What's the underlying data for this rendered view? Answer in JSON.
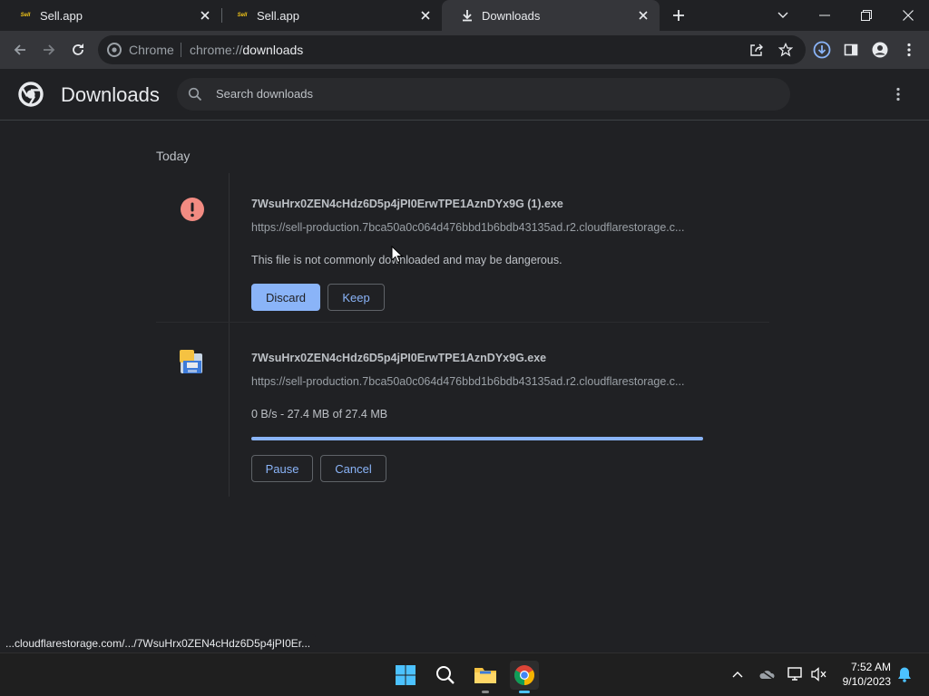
{
  "tabs": [
    {
      "title": "Sell.app",
      "favicon": "sell-app-logo",
      "favicon_text": "Sell"
    },
    {
      "title": "Sell.app",
      "favicon": "sell-app-logo",
      "favicon_text": "Sell"
    },
    {
      "title": "Downloads",
      "favicon": "download-icon",
      "active": true
    }
  ],
  "omnibox": {
    "site_label": "Chrome",
    "url_scheme": "chrome://",
    "url_host": "downloads"
  },
  "downloads_page": {
    "title": "Downloads",
    "search_placeholder": "Search downloads",
    "date_group": "Today",
    "items": [
      {
        "filename": "7WsuHrx0ZEN4cHdz6D5p4jPI0ErwTPE1AznDYx9G (1).exe",
        "url": "https://sell-production.7bca50a0c064d476bbd1b6bdb43135ad.r2.cloudflarestorage.c...",
        "status": "This file is not commonly downloaded and may be dangerous.",
        "icon": "warning-icon",
        "buttons": {
          "discard": "Discard",
          "keep": "Keep"
        }
      },
      {
        "filename": "7WsuHrx0ZEN4cHdz6D5p4jPI0ErwTPE1AznDYx9G.exe",
        "url": "https://sell-production.7bca50a0c064d476bbd1b6bdb43135ad.r2.cloudflarestorage.c...",
        "status": "0 B/s - 27.4 MB of 27.4 MB",
        "progress": 1.0,
        "icon": "installer-file-icon",
        "buttons": {
          "pause": "Pause",
          "cancel": "Cancel"
        }
      }
    ]
  },
  "status_bar": "...cloudflarestorage.com/.../7WsuHrx0ZEN4cHdz6D5p4jPI0Er...",
  "taskbar": {
    "time": "7:52 AM",
    "date": "9/10/2023"
  },
  "colors": {
    "accent": "#8ab4f8",
    "background": "#202124",
    "toolbar": "#35363a",
    "warning": "#f28b82"
  }
}
